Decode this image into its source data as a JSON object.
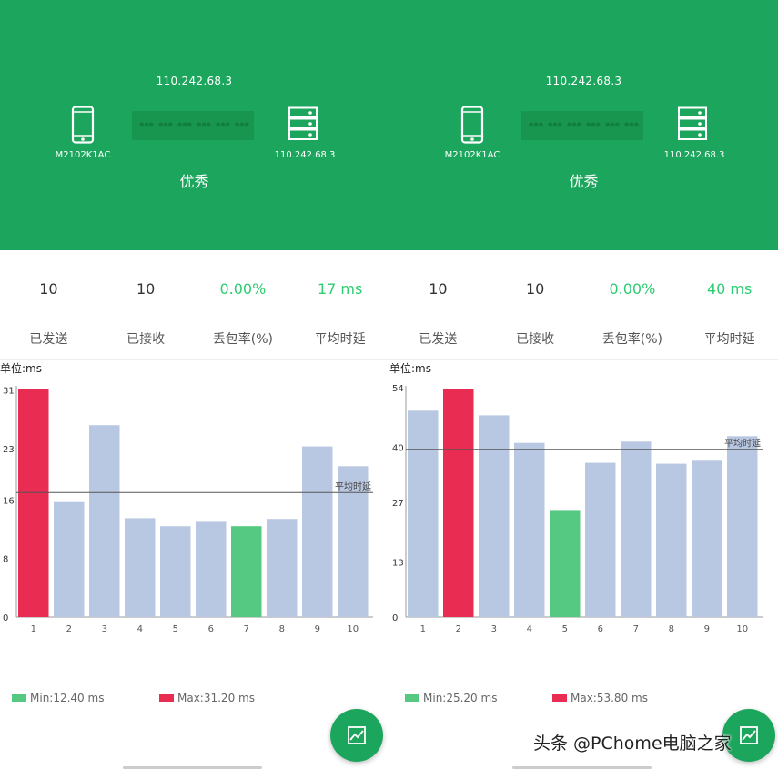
{
  "colors": {
    "header": "#1ca55c",
    "bar": "#b9c8e2",
    "max": "#e92d52",
    "min": "#55c882",
    "good": "#2ecc71"
  },
  "watermark": "头条 @PChome电脑之家",
  "panels": [
    {
      "ip_top": "110.242.68.3",
      "device_name": "M2102K1AC",
      "server_ip": "110.242.68.3",
      "quality": "优秀",
      "stats": [
        {
          "value": "10",
          "label": "已发送"
        },
        {
          "value": "10",
          "label": "已接收"
        },
        {
          "value": "0.00%",
          "label": "丢包率(%)"
        },
        {
          "value": "17 ms",
          "label": "平均时延"
        }
      ],
      "unit": "单位:ms",
      "legend": {
        "min": "Min:12.40 ms",
        "max": "Max:31.20 ms"
      },
      "chart_data": {
        "type": "bar",
        "categories": [
          "1",
          "2",
          "3",
          "4",
          "5",
          "6",
          "7",
          "8",
          "9",
          "10"
        ],
        "values": [
          31.2,
          15.7,
          26.2,
          13.5,
          12.4,
          13.0,
          12.4,
          13.4,
          23.3,
          20.6
        ],
        "yticks": [
          "31",
          "23",
          "16",
          "8",
          "0"
        ],
        "ylim": [
          0,
          31.2
        ],
        "avg": 17,
        "avg_label": "平均时延",
        "max_index": 0,
        "min_index": 6
      }
    },
    {
      "ip_top": "110.242.68.3",
      "device_name": "M2102K1AC",
      "server_ip": "110.242.68.3",
      "quality": "优秀",
      "stats": [
        {
          "value": "10",
          "label": "已发送"
        },
        {
          "value": "10",
          "label": "已接收"
        },
        {
          "value": "0.00%",
          "label": "丢包率(%)"
        },
        {
          "value": "40 ms",
          "label": "平均时延"
        }
      ],
      "unit": "单位:ms",
      "legend": {
        "min": "Min:25.20 ms",
        "max": "Max:53.80 ms"
      },
      "chart_data": {
        "type": "bar",
        "categories": [
          "1",
          "2",
          "3",
          "4",
          "5",
          "6",
          "7",
          "8",
          "9",
          "10"
        ],
        "values": [
          48.6,
          53.8,
          47.5,
          41.0,
          25.2,
          36.3,
          41.3,
          36.1,
          36.8,
          42.6
        ],
        "yticks": [
          "54",
          "40",
          "27",
          "13",
          "0"
        ],
        "ylim": [
          0,
          53.8
        ],
        "avg": 39.5,
        "avg_label": "平均时延",
        "max_index": 1,
        "min_index": 4
      }
    }
  ]
}
